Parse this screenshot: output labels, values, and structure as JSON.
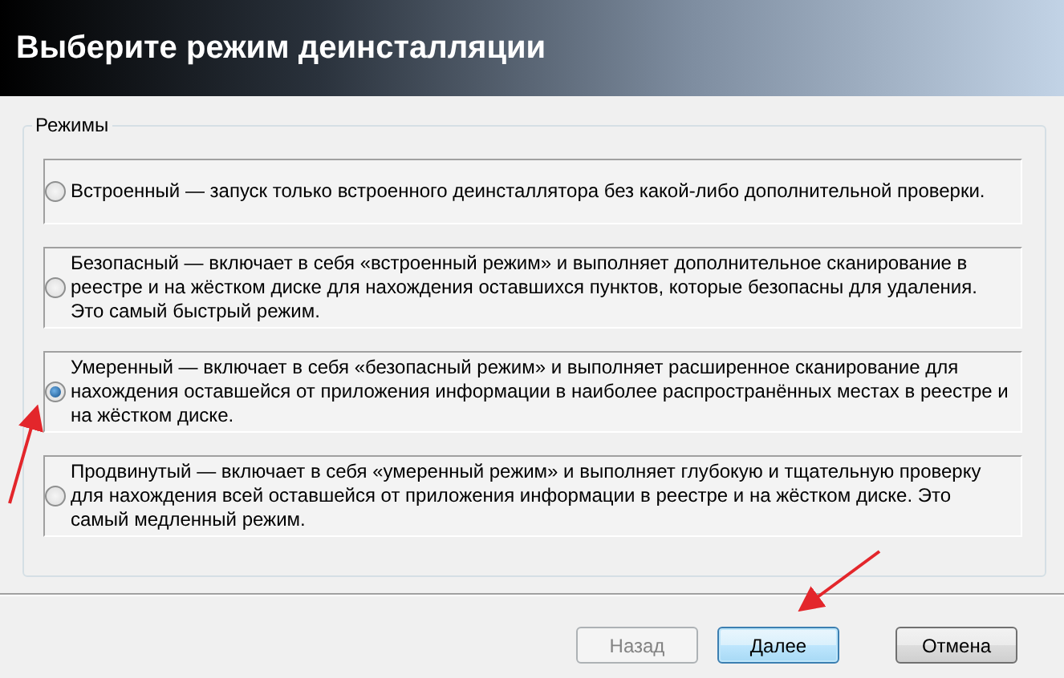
{
  "header": {
    "title": "Выберите режим деинсталляции"
  },
  "group": {
    "legend": "Режимы",
    "options": [
      {
        "text": "Встроенный — запуск только встроенного деинсталлятора без какой-либо дополнительной проверки.",
        "selected": false
      },
      {
        "text": "Безопасный — включает в себя «встроенный режим» и выполняет дополнительное сканирование в реестре и на жёстком диске для нахождения оставшихся пунктов, которые безопасны для удаления. Это самый быстрый режим.",
        "selected": false
      },
      {
        "text": "Умеренный — включает в себя «безопасный режим» и выполняет расширенное сканирование для нахождения оставшейся от приложения информации в наиболее распространённых местах в реестре и на жёстком диске.",
        "selected": true
      },
      {
        "text": "Продвинутый — включает в себя «умеренный режим» и выполняет глубокую и тщательную проверку для нахождения всей оставшейся от приложения информации в реестре и на жёстком диске. Это самый медленный режим.",
        "selected": false
      }
    ]
  },
  "buttons": [
    {
      "label": "Назад",
      "disabled": true,
      "default": false
    },
    {
      "label": "Далее",
      "disabled": false,
      "default": true
    },
    {
      "label": "Отмена",
      "disabled": false,
      "default": false
    }
  ]
}
